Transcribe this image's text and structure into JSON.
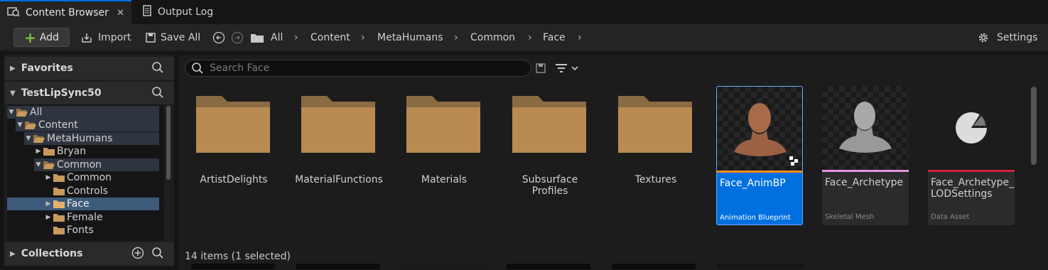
{
  "tabs": [
    {
      "label": "Content Browser",
      "close": "✕"
    },
    {
      "label": "Output Log"
    }
  ],
  "toolbar": {
    "add_label": "Add",
    "import_label": "Import",
    "save_all_label": "Save All",
    "settings_label": "Settings"
  },
  "breadcrumb": [
    "All",
    "Content",
    "MetaHumans",
    "Common",
    "Face"
  ],
  "sidebar": {
    "favorites": "Favorites",
    "project": "TestLipSync50",
    "collections": "Collections",
    "tree": [
      {
        "label": "All"
      },
      {
        "label": "Content"
      },
      {
        "label": "MetaHumans"
      },
      {
        "label": "Bryan"
      },
      {
        "label": "Common"
      },
      {
        "label": "Common"
      },
      {
        "label": "Controls"
      },
      {
        "label": "Face"
      },
      {
        "label": "Female"
      },
      {
        "label": "Fonts"
      }
    ]
  },
  "search": {
    "placeholder": "Search Face"
  },
  "folders": [
    {
      "name": "ArtistDelights"
    },
    {
      "name": "MaterialFunctions"
    },
    {
      "name": "Materials"
    },
    {
      "name": "Subsurface Profiles"
    },
    {
      "name": "Textures"
    }
  ],
  "assets": [
    {
      "name": "Face_AnimBP",
      "type": "Animation Blueprint",
      "color": "#ff8c00"
    },
    {
      "name": "Face_Archetype",
      "type": "Skeletal Mesh",
      "color": "#e892e0"
    },
    {
      "name": "Face_Archetype_ LODSettings",
      "type": "Data Asset",
      "color": "#d0243a"
    }
  ],
  "status": "14 items (1 selected)",
  "colors": {
    "accent": "#0070e0",
    "folder": "#b98b52",
    "add_plus": "#7cc247"
  }
}
